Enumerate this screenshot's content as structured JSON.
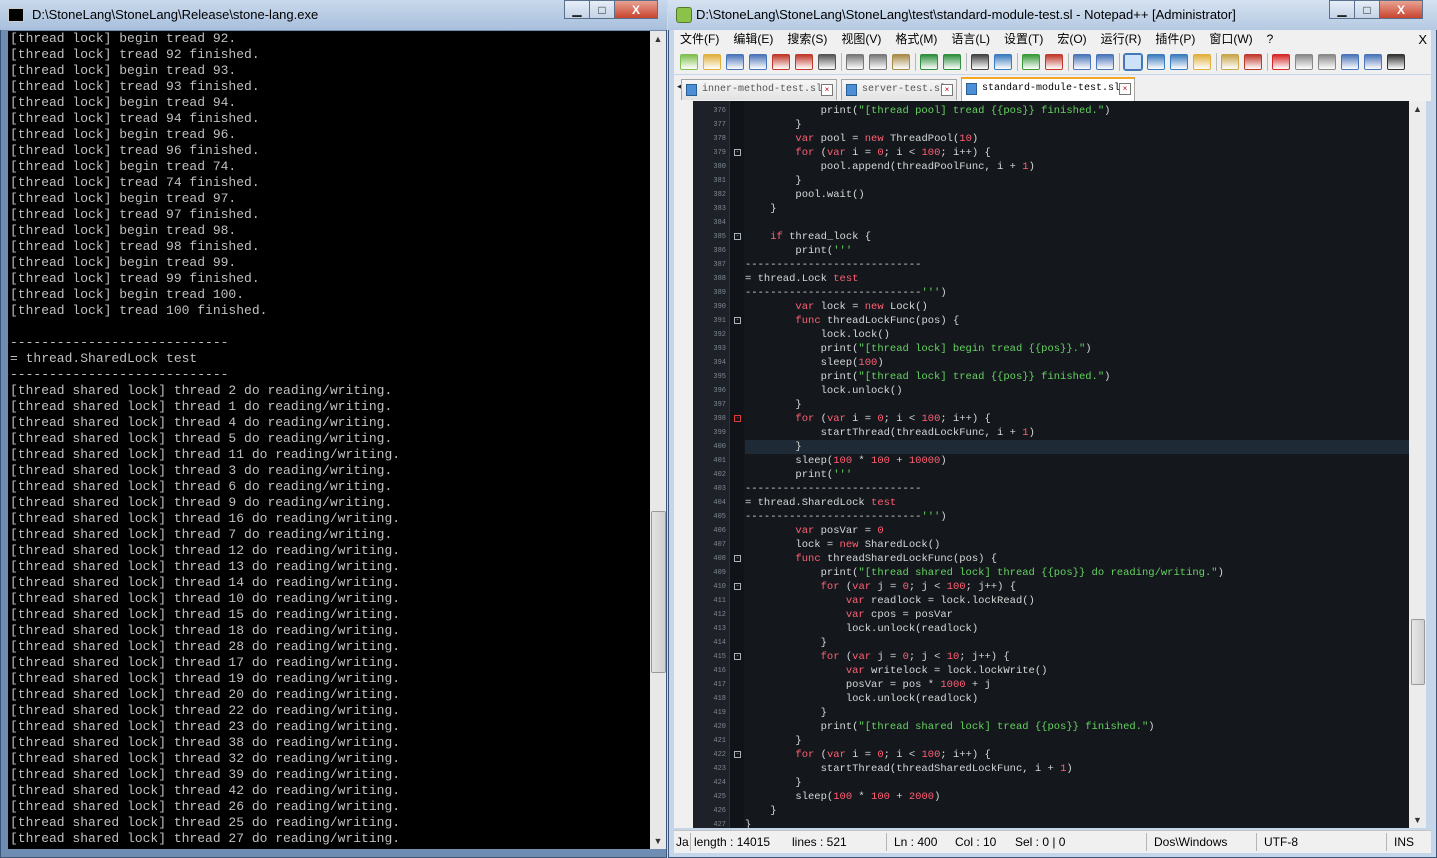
{
  "console": {
    "title": "D:\\StoneLang\\StoneLang\\Release\\stone-lang.exe",
    "buttons": {
      "minimize": "▁",
      "maximize": "□",
      "close": "X"
    },
    "lines": [
      "[thread lock] begin tread 92.",
      "[thread lock] tread 92 finished.",
      "[thread lock] begin tread 93.",
      "[thread lock] tread 93 finished.",
      "[thread lock] begin tread 94.",
      "[thread lock] tread 94 finished.",
      "[thread lock] begin tread 96.",
      "[thread lock] tread 96 finished.",
      "[thread lock] begin tread 74.",
      "[thread lock] tread 74 finished.",
      "[thread lock] begin tread 97.",
      "[thread lock] tread 97 finished.",
      "[thread lock] begin tread 98.",
      "[thread lock] tread 98 finished.",
      "[thread lock] begin tread 99.",
      "[thread lock] tread 99 finished.",
      "[thread lock] begin tread 100.",
      "[thread lock] tread 100 finished.",
      "",
      "----------------------------",
      "= thread.SharedLock test",
      "----------------------------",
      "[thread shared lock] thread 2 do reading/writing.",
      "[thread shared lock] thread 1 do reading/writing.",
      "[thread shared lock] thread 4 do reading/writing.",
      "[thread shared lock] thread 5 do reading/writing.",
      "[thread shared lock] thread 11 do reading/writing.",
      "[thread shared lock] thread 3 do reading/writing.",
      "[thread shared lock] thread 6 do reading/writing.",
      "[thread shared lock] thread 9 do reading/writing.",
      "[thread shared lock] thread 16 do reading/writing.",
      "[thread shared lock] thread 7 do reading/writing.",
      "[thread shared lock] thread 12 do reading/writing.",
      "[thread shared lock] thread 13 do reading/writing.",
      "[thread shared lock] thread 14 do reading/writing.",
      "[thread shared lock] thread 10 do reading/writing.",
      "[thread shared lock] thread 15 do reading/writing.",
      "[thread shared lock] thread 18 do reading/writing.",
      "[thread shared lock] thread 28 do reading/writing.",
      "[thread shared lock] thread 17 do reading/writing.",
      "[thread shared lock] thread 19 do reading/writing.",
      "[thread shared lock] thread 20 do reading/writing.",
      "[thread shared lock] thread 22 do reading/writing.",
      "[thread shared lock] thread 23 do reading/writing.",
      "[thread shared lock] thread 38 do reading/writing.",
      "[thread shared lock] thread 32 do reading/writing.",
      "[thread shared lock] thread 39 do reading/writing.",
      "[thread shared lock] thread 42 do reading/writing.",
      "[thread shared lock] thread 26 do reading/writing.",
      "[thread shared lock] thread 25 do reading/writing.",
      "[thread shared lock] thread 27 do reading/writing."
    ]
  },
  "npp": {
    "title": "D:\\StoneLang\\StoneLang\\StoneLang\\test\\standard-module-test.sl - Notepad++ [Administrator]",
    "buttons": {
      "minimize": "▁",
      "maximize": "□",
      "close": "X"
    },
    "menu": [
      "文件(F)",
      "编辑(E)",
      "搜索(S)",
      "视图(V)",
      "格式(M)",
      "语言(L)",
      "设置(T)",
      "宏(O)",
      "运行(R)",
      "插件(P)",
      "窗口(W)",
      "?"
    ],
    "menu_close": "X",
    "toolbar_icons": [
      "new-file-icon",
      "open-file-icon",
      "save-icon",
      "save-all-icon",
      "close-icon",
      "close-all-icon",
      "print-icon",
      "cut-icon",
      "copy-icon",
      "paste-icon",
      "undo-icon",
      "redo-icon",
      "find-icon",
      "replace-icon",
      "zoom-in-icon",
      "zoom-out-icon",
      "sync-v-icon",
      "sync-h-icon",
      "word-wrap-icon",
      "show-all-chars-icon",
      "indent-guide-icon",
      "doc-map-icon",
      "function-list-icon",
      "folder-workspace-icon",
      "record-macro-icon",
      "stop-macro-icon",
      "play-macro-icon",
      "run-macro-multiple-icon",
      "save-macro-icon",
      "spell-check-icon"
    ],
    "tabs": [
      {
        "label": "inner-method-test.sl",
        "active": false
      },
      {
        "label": "server-test.sl",
        "active": false
      },
      {
        "label": "standard-module-test.sl",
        "active": true
      }
    ],
    "current_line": 400,
    "code": [
      {
        "n": "376",
        "fold": "",
        "t": "            print(\"[thread pool] tread {{pos}} finished.\")"
      },
      {
        "n": "377",
        "fold": "",
        "t": "        }"
      },
      {
        "n": "378",
        "fold": "",
        "t": "        var pool = new ThreadPool(10)"
      },
      {
        "n": "379",
        "fold": "-",
        "t": "        for (var i = 0; i < 100; i++) {"
      },
      {
        "n": "380",
        "fold": "",
        "t": "            pool.append(threadPoolFunc, i + 1)"
      },
      {
        "n": "381",
        "fold": "",
        "t": "        }"
      },
      {
        "n": "382",
        "fold": "",
        "t": "        pool.wait()"
      },
      {
        "n": "383",
        "fold": "",
        "t": "    }"
      },
      {
        "n": "384",
        "fold": "",
        "t": ""
      },
      {
        "n": "385",
        "fold": "-",
        "t": "    if thread_lock {"
      },
      {
        "n": "386",
        "fold": "",
        "t": "        print('''"
      },
      {
        "n": "387",
        "fold": "",
        "t": "----------------------------"
      },
      {
        "n": "388",
        "fold": "",
        "t": "= thread.Lock test"
      },
      {
        "n": "389",
        "fold": "",
        "t": "----------------------------''')"
      },
      {
        "n": "390",
        "fold": "",
        "t": "        var lock = new Lock()"
      },
      {
        "n": "391",
        "fold": "-",
        "t": "        func threadLockFunc(pos) {"
      },
      {
        "n": "392",
        "fold": "",
        "t": "            lock.lock()"
      },
      {
        "n": "393",
        "fold": "",
        "t": "            print(\"[thread lock] begin tread {{pos}}.\")"
      },
      {
        "n": "394",
        "fold": "",
        "t": "            sleep(100)"
      },
      {
        "n": "395",
        "fold": "",
        "t": "            print(\"[thread lock] tread {{pos}} finished.\")"
      },
      {
        "n": "396",
        "fold": "",
        "t": "            lock.unlock()"
      },
      {
        "n": "397",
        "fold": "",
        "t": "        }"
      },
      {
        "n": "398",
        "fold": "r",
        "t": "        for (var i = 0; i < 100; i++) {"
      },
      {
        "n": "399",
        "fold": "",
        "t": "            startThread(threadLockFunc, i + 1)"
      },
      {
        "n": "400",
        "fold": "",
        "t": "        }"
      },
      {
        "n": "401",
        "fold": "",
        "t": "        sleep(100 * 100 + 10000)"
      },
      {
        "n": "402",
        "fold": "",
        "t": "        print('''"
      },
      {
        "n": "403",
        "fold": "",
        "t": "----------------------------"
      },
      {
        "n": "404",
        "fold": "",
        "t": "= thread.SharedLock test"
      },
      {
        "n": "405",
        "fold": "",
        "t": "----------------------------''')"
      },
      {
        "n": "406",
        "fold": "",
        "t": "        var posVar = 0"
      },
      {
        "n": "407",
        "fold": "",
        "t": "        lock = new SharedLock()"
      },
      {
        "n": "408",
        "fold": "-",
        "t": "        func threadSharedLockFunc(pos) {"
      },
      {
        "n": "409",
        "fold": "",
        "t": "            print(\"[thread shared lock] thread {{pos}} do reading/writing.\")"
      },
      {
        "n": "410",
        "fold": "-",
        "t": "            for (var j = 0; j < 100; j++) {"
      },
      {
        "n": "411",
        "fold": "",
        "t": "                var readlock = lock.lockRead()"
      },
      {
        "n": "412",
        "fold": "",
        "t": "                var cpos = posVar"
      },
      {
        "n": "413",
        "fold": "",
        "t": "                lock.unlock(readlock)"
      },
      {
        "n": "414",
        "fold": "",
        "t": "            }"
      },
      {
        "n": "415",
        "fold": "-",
        "t": "            for (var j = 0; j < 10; j++) {"
      },
      {
        "n": "416",
        "fold": "",
        "t": "                var writelock = lock.lockWrite()"
      },
      {
        "n": "417",
        "fold": "",
        "t": "                posVar = pos * 1000 + j"
      },
      {
        "n": "418",
        "fold": "",
        "t": "                lock.unlock(readlock)"
      },
      {
        "n": "419",
        "fold": "",
        "t": "            }"
      },
      {
        "n": "420",
        "fold": "",
        "t": "            print(\"[thread shared lock] tread {{pos}} finished.\")"
      },
      {
        "n": "421",
        "fold": "",
        "t": "        }"
      },
      {
        "n": "422",
        "fold": "-",
        "t": "        for (var i = 0; i < 100; i++) {"
      },
      {
        "n": "423",
        "fold": "",
        "t": "            startThread(threadSharedLockFunc, i + 1)"
      },
      {
        "n": "424",
        "fold": "",
        "t": "        }"
      },
      {
        "n": "425",
        "fold": "",
        "t": "        sleep(100 * 100 + 2000)"
      },
      {
        "n": "426",
        "fold": "",
        "t": "    }"
      },
      {
        "n": "427",
        "fold": "",
        "t": "}"
      }
    ],
    "status": {
      "lang": "Ja",
      "length": "length : 14015",
      "lines": "lines : 521",
      "ln": "Ln : 400",
      "col": "Col : 10",
      "sel": "Sel : 0 | 0",
      "eol": "Dos\\Windows",
      "encoding": "UTF-8",
      "mode": "INS"
    },
    "colors": {
      "keyword": "#ff5f73",
      "string": "#64d25f",
      "number": "#ff5f73",
      "editor_bg": "#14181d"
    }
  }
}
